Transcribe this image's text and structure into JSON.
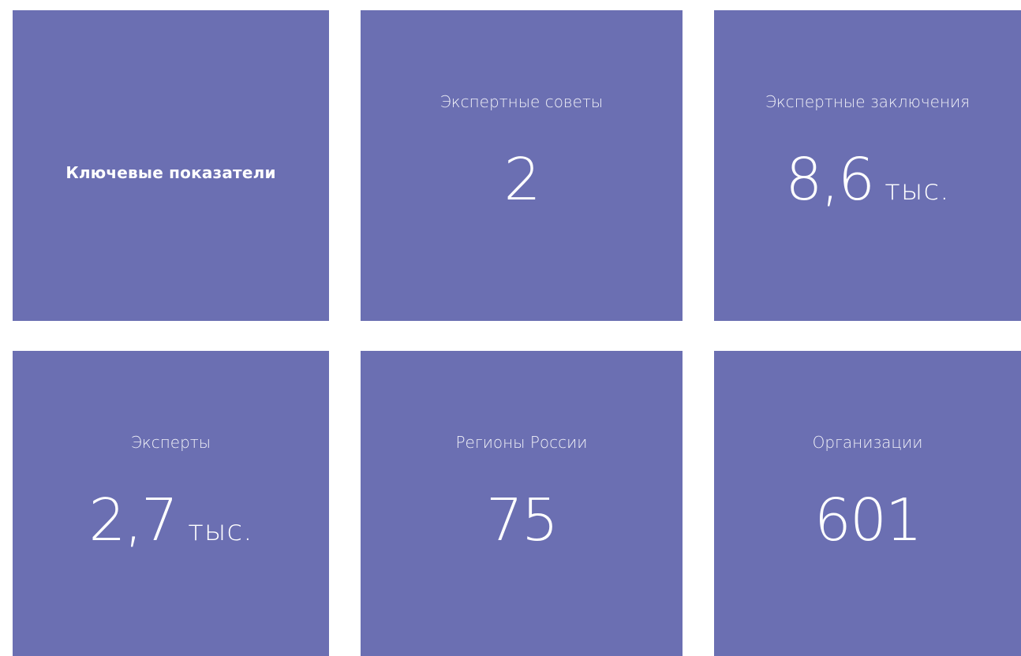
{
  "section": {
    "title": "Ключевые показатели"
  },
  "tiles": [
    {
      "label": "Экспертные советы",
      "value": "2",
      "unit": ""
    },
    {
      "label": "Экспертные заключения",
      "value": "8,6",
      "unit": "тыс."
    },
    {
      "label": "Эксперты",
      "value": "2,7",
      "unit": "тыс."
    },
    {
      "label": "Регионы России",
      "value": "75",
      "unit": ""
    },
    {
      "label": "Организации",
      "value": "601",
      "unit": ""
    }
  ],
  "colors": {
    "tile_background": "#6b6fb2",
    "text": "#ffffff",
    "page_background": "#ffffff"
  }
}
